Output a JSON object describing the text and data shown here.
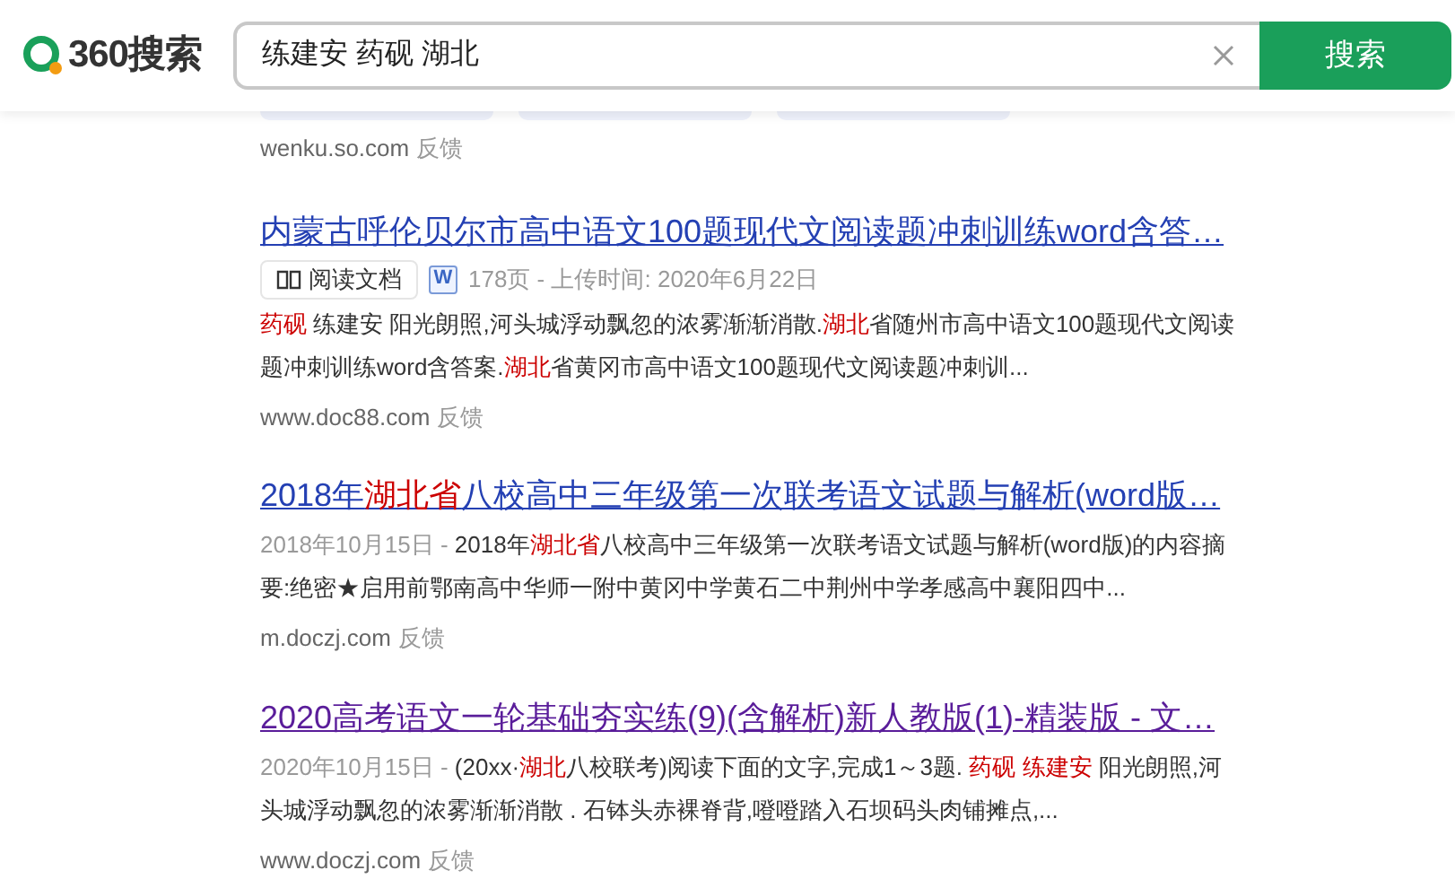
{
  "header": {
    "logo_text": "360搜索",
    "query": "练建安 药砚 湖北",
    "search_button": "搜索"
  },
  "related_chips": [
    {
      "kind": "chip"
    },
    {
      "kind": "chip"
    },
    {
      "kind": "chip"
    }
  ],
  "top_source": {
    "site": "wenku.so.com",
    "feedback": "反馈"
  },
  "results": [
    {
      "title": [
        {
          "text": "内蒙古呼伦贝尔市高中语文100题现代文阅读题冲刺训练word含答…",
          "highlight": false
        }
      ],
      "visited": false,
      "doc_meta": {
        "read_label": "阅读文档",
        "format": "W",
        "info": "178页 - 上传时间: 2020年6月22日"
      },
      "snippet": [
        {
          "text": "药砚",
          "highlight": true
        },
        {
          "text": " 练建安 阳光朗照,河头城浮动飘忽的浓雾渐渐消散.",
          "highlight": false
        },
        {
          "text": "湖北",
          "highlight": true
        },
        {
          "text": "省随州市高中语文100题现代文阅读题冲刺训练word含答案.",
          "highlight": false
        },
        {
          "text": "湖北",
          "highlight": true
        },
        {
          "text": "省黄冈市高中语文100题现代文阅读题冲刺训...",
          "highlight": false
        }
      ],
      "site": "www.doc88.com",
      "feedback": "反馈"
    },
    {
      "title": [
        {
          "text": "2018年",
          "highlight": false
        },
        {
          "text": "湖北省",
          "highlight": true
        },
        {
          "text": "八校高中三年级第一次联考语文试题与解析(word版…",
          "highlight": false
        }
      ],
      "visited": false,
      "date": "2018年10月15日 - ",
      "snippet": [
        {
          "text": "2018年",
          "highlight": false
        },
        {
          "text": "湖北省",
          "highlight": true
        },
        {
          "text": "八校高中三年级第一次联考语文试题与解析(word版)的内容摘要:绝密★启用前鄂南高中华师一附中黄冈中学黄石二中荆州中学孝感高中襄阳四中...",
          "highlight": false
        }
      ],
      "site": "m.doczj.com",
      "feedback": "反馈"
    },
    {
      "title": [
        {
          "text": "2020高考语文一轮基础夯实练(9)(含解析)新人教版(1)-精装版 - 文…",
          "highlight": false
        }
      ],
      "visited": true,
      "date": "2020年10月15日 - ",
      "snippet": [
        {
          "text": "(20xx·",
          "highlight": false
        },
        {
          "text": "湖北",
          "highlight": true
        },
        {
          "text": "八校联考)阅读下面的文字,完成1～3题. ",
          "highlight": false
        },
        {
          "text": "药砚 练建安",
          "highlight": true
        },
        {
          "text": " 阳光朗照,河头城浮动飘忽的浓雾渐渐消散 . 石钵头赤裸脊背,噔噔踏入石坝码头肉铺摊点,...",
          "highlight": false
        }
      ],
      "site": "www.doczj.com",
      "feedback": "反馈"
    }
  ]
}
